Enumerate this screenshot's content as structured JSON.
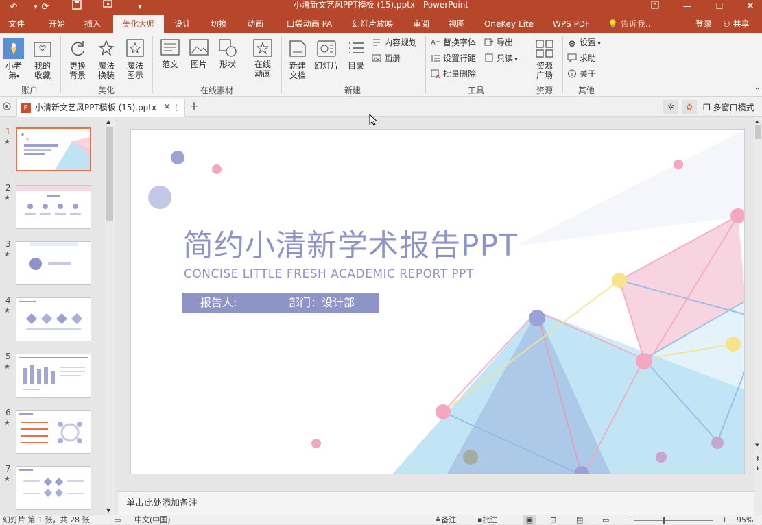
{
  "window": {
    "title": "小清新文艺风PPT模板 (15).pptx - PowerPoint"
  },
  "quick_access": {
    "undo_icon": "undo-icon",
    "redo_icon": "redo-icon",
    "save_icon": "save-icon",
    "present_icon": "present-icon",
    "customize_icon": "chevron-down-icon"
  },
  "tabs": [
    "文件",
    "开始",
    "插入",
    "美化大师",
    "设计",
    "切换",
    "动画",
    "口袋动画 PA",
    "幻灯片放映",
    "审阅",
    "视图",
    "OneKey Lite",
    "WPS PDF"
  ],
  "active_tab": "美化大师",
  "tellme": "告诉我...",
  "signin": "登录",
  "share": "共享",
  "ribbon": {
    "account": {
      "label": "账户",
      "user": "小老\n弟",
      "user_btn": "小老",
      "user_btn2": "弟",
      "fav1": "我的",
      "fav2": "收藏"
    },
    "beautify": {
      "label": "美化",
      "bg1": "更换",
      "bg2": "背景",
      "magic1": "魔法",
      "magic2": "换装",
      "chart1": "魔法",
      "chart2": "图示"
    },
    "online": {
      "label": "在线素材",
      "template": "范文",
      "picture": "图片",
      "shape": "形状",
      "anim1": "在线",
      "anim2": "动画"
    },
    "new": {
      "label": "新建",
      "doc1": "新建",
      "doc2": "文档",
      "slide": "幻灯片",
      "toc": "目录",
      "plan": "内容规划",
      "album": "画册"
    },
    "tools": {
      "label": "工具",
      "replace_font": "替换字体",
      "export": "导出",
      "line_spacing": "设置行距",
      "readonly": "只读",
      "batch_delete": "批量删除"
    },
    "resources": {
      "label": "资源",
      "plaza1": "资源",
      "plaza2": "广场"
    },
    "other": {
      "label": "其他",
      "settings": "设置",
      "help": "求助",
      "about": "关于"
    }
  },
  "doc_tab": {
    "name": "小清新文艺风PPT模板 (15).pptx",
    "multi_window": "多窗口模式"
  },
  "thumbnails": [
    {
      "num": "1",
      "star": "★"
    },
    {
      "num": "2",
      "star": "★"
    },
    {
      "num": "3",
      "star": "★"
    },
    {
      "num": "4",
      "star": "★"
    },
    {
      "num": "5",
      "star": "★"
    },
    {
      "num": "6",
      "star": "★"
    },
    {
      "num": "7",
      "star": "★"
    }
  ],
  "slide": {
    "title_zh": "简约小清新学术报告PPT",
    "title_en": "CONCISE LITTLE FRESH ACADEMIC REPORT PPT",
    "reporter": "报告人:",
    "department": "部门：设计部"
  },
  "notes_placeholder": "单击此处添加备注",
  "status": {
    "slide_info": "幻灯片 第 1 张，共 28 张",
    "language": "中文(中国)",
    "notes": "备注",
    "comments": "批注",
    "zoom": "95%"
  },
  "colors": {
    "accent": "#b7472a",
    "slide_text": "#8e95c6"
  }
}
